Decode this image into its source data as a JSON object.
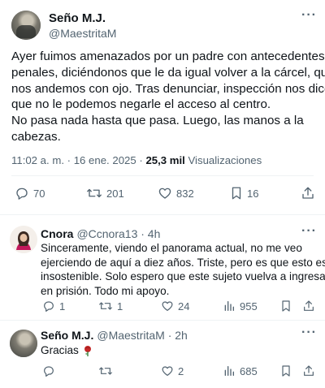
{
  "main_tweet": {
    "author_name": "Seño M.J.",
    "author_handle": "@MaestritaM",
    "more_icon": "···",
    "text_lines": [
      "Ayer fuimos amenazados por un padre con antecedentes",
      "penales, diciéndonos que le da igual volver a la cárcel, que",
      "nos andemos con ojo. Tras denunciar, inspección nos dice",
      "que no le podemos negarle el acceso al centro.",
      "No pasa nada hasta que pasa. Luego, las manos a la",
      "cabezas."
    ],
    "timestamp": "11:02 a. m. · 16 ene. 2025 · ",
    "views_count": "25,3 mil",
    "views_label": "Visualizaciones",
    "actions": {
      "replies": "70",
      "retweets": "201",
      "likes": "832",
      "bookmarks": "16"
    }
  },
  "replies": [
    {
      "author_name": "Cnora",
      "author_handle": "@Ccnora13 · 4h",
      "text_lines": [
        "Sinceramente, viendo el panorama actual, no me veo",
        "ejerciendo de aquí a diez años. Triste, pero es que esto es",
        "insostenible. Solo espero que este sujeto vuelva a ingresar",
        "en prisión. Todo mi apoyo."
      ],
      "actions": {
        "replies": "1",
        "retweets": "1",
        "likes": "24",
        "views": "955"
      }
    },
    {
      "author_name": "Seño M.J.",
      "author_handle": "@MaestritaM · 2h",
      "text": "Gracias",
      "emoji": "rose",
      "actions": {
        "replies": "",
        "retweets": "",
        "likes": "2",
        "views": "685"
      }
    }
  ],
  "colors": {
    "text": "#0f1419",
    "secondary": "#536471",
    "divider": "#eff3f4"
  }
}
